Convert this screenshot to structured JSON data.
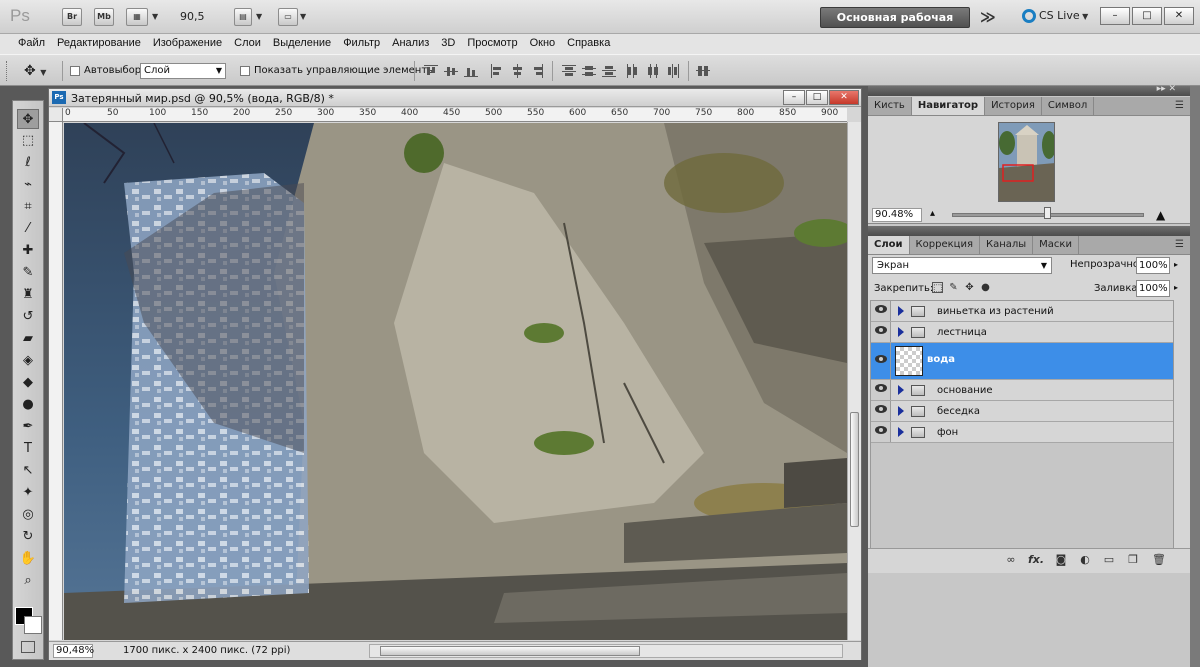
{
  "appbar": {
    "logo": "Ps",
    "bridge_label": "Br",
    "minibridge_label": "Mb",
    "zoom": "90,5",
    "workspace_label": "Основная рабочая среда",
    "more_glyph": "≫",
    "cslive_label": "CS Live",
    "window_controls": [
      "–",
      "□",
      "✕"
    ]
  },
  "menubar": {
    "items": [
      "Файл",
      "Редактирование",
      "Изображение",
      "Слои",
      "Выделение",
      "Фильтр",
      "Анализ",
      "3D",
      "Просмотр",
      "Окно",
      "Справка"
    ]
  },
  "options": {
    "autoselect_label": "Автовыбор:",
    "autoselect_value": "Слой",
    "show_controls_label": "Показать управляющие элементы"
  },
  "document": {
    "title": "Затерянный мир.psd @ 90,5% (вода, RGB/8) *",
    "ps_badge": "Ps",
    "ruler_ticks": [
      "0",
      "50",
      "100",
      "150",
      "200",
      "250",
      "300",
      "350",
      "400",
      "450",
      "500",
      "550",
      "600",
      "650",
      "700",
      "750",
      "800",
      "850",
      "900"
    ],
    "status_zoom": "90,48%",
    "status_info": "1700 пикс. x 2400 пикс. (72 ppi)"
  },
  "panels": {
    "top_tabs": [
      "Кисть",
      "Навигатор",
      "История",
      "Символ"
    ],
    "top_active": "Навигатор",
    "navigator_zoom": "90.48%",
    "layer_tabs": [
      "Слои",
      "Коррекция",
      "Каналы",
      "Маски"
    ],
    "layer_active": "Слои",
    "blend_mode": "Экран",
    "opacity_label": "Непрозрачность:",
    "opacity_value": "100%",
    "lock_label": "Закрепить:",
    "fill_label": "Заливка:",
    "fill_value": "100%",
    "layers": [
      {
        "name": "виньетка из растений",
        "type": "group"
      },
      {
        "name": "лестница",
        "type": "group"
      },
      {
        "name": "вода",
        "type": "layer",
        "selected": true
      },
      {
        "name": "основание",
        "type": "group"
      },
      {
        "name": "беседка",
        "type": "group"
      },
      {
        "name": "фон",
        "type": "group"
      }
    ],
    "footer_icons": [
      "link-icon",
      "fx-icon",
      "mask-icon",
      "adjustment-icon",
      "folder-icon",
      "new-layer-icon",
      "trash-icon"
    ],
    "fx_label": "fx."
  },
  "colors": {
    "selection": "#3d8ee8",
    "workspace_button": "#5d5d5d",
    "close_button": "#c6392b"
  }
}
